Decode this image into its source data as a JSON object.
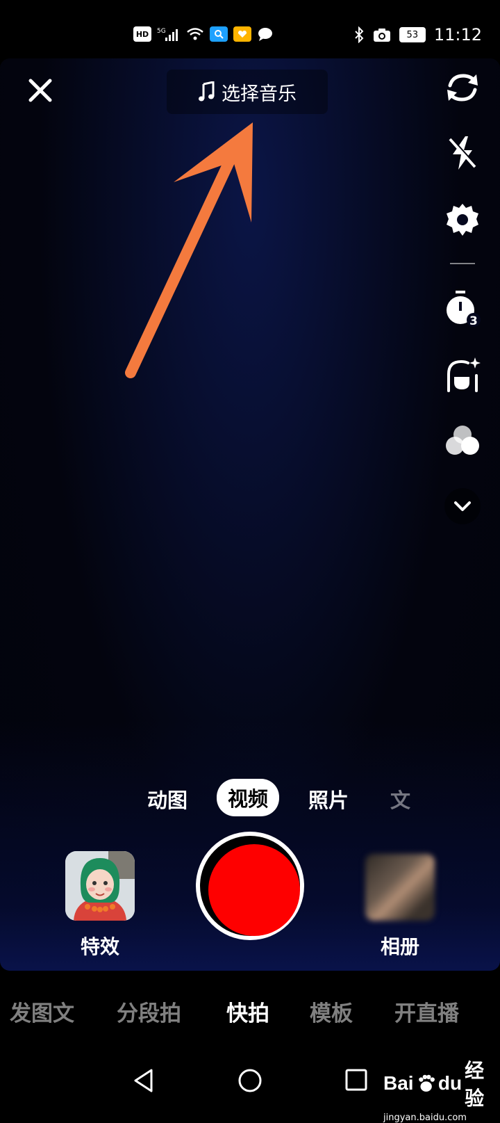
{
  "status_bar": {
    "network_badge": "HD",
    "network_type": "5G",
    "battery_level": "53",
    "time": "11:12",
    "icons": [
      "hd-icon",
      "signal-icon",
      "wifi-icon",
      "search-app-icon",
      "heart-app-icon",
      "chat-icon",
      "bluetooth-icon",
      "camera-icon",
      "battery-icon"
    ]
  },
  "top": {
    "music_label": "选择音乐",
    "music_icon": "music-note-icon",
    "close_icon": "close-icon",
    "annotation_color": "#f47a3e"
  },
  "right_rail": {
    "icons": [
      "flip-camera-icon",
      "flash-off-icon",
      "settings-icon",
      "timer-3s-icon",
      "beauty-icon",
      "filter-icon",
      "expand-chevron-icon"
    ],
    "timer_value": "3"
  },
  "modes": {
    "items": [
      "动图",
      "视频",
      "照片",
      "文"
    ],
    "active": "视频"
  },
  "capture": {
    "effects_label": "特效",
    "album_label": "相册",
    "record_color": "#fe0000"
  },
  "bottom_tabs": {
    "items": [
      "发图文",
      "分段拍",
      "快拍",
      "模板",
      "开直播"
    ],
    "active": "快拍"
  },
  "watermark": {
    "logo_text_a": "Bai",
    "logo_text_b": "du",
    "logo_text_c": "经验",
    "url": "jingyan.baidu.com"
  }
}
